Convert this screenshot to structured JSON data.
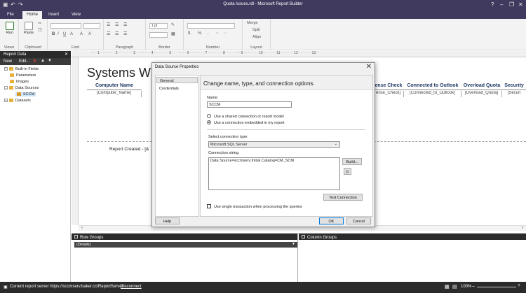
{
  "window": {
    "title": "Quota Issues.rdl - Microsoft Report Builder",
    "controls": [
      "?",
      "–",
      "❐",
      "✕"
    ]
  },
  "ribbon_tabs": [
    "File",
    "Home",
    "Insert",
    "View"
  ],
  "ribbon": {
    "run_label": "Run",
    "paste_label": "Paste",
    "groups": [
      "Views",
      "Clipboard",
      "Font",
      "Paragraph",
      "Border",
      "Number",
      "Layout"
    ],
    "border_width": "1 pt",
    "merge_label": "Merge",
    "split_label": "Split",
    "align_label": "Align"
  },
  "report_data": {
    "title": "Report Data",
    "close": "✕",
    "toolbar": {
      "new": "New",
      "edit": "Edit..."
    },
    "tree": [
      {
        "label": "Built-in Fields",
        "expander": "+"
      },
      {
        "label": "Parameters",
        "expander": ""
      },
      {
        "label": "Images",
        "expander": ""
      },
      {
        "label": "Data Sources",
        "expander": "–"
      },
      {
        "label": "SCCM",
        "expander": ""
      },
      {
        "label": "Datasets",
        "expander": "+"
      }
    ]
  },
  "ruler_text": "· · · 1 · · · · · · · 2 · · · · · · · 3 · · · · · · · 4 · · · · · · · 5 · · · · · · · 6 · · · · · · · 7 · · · · · · · 8 · · · · · · · 9 · · · · · · · 10 · · · · · · 11 · · · · · · 12 · · · · · · 13 ·",
  "report": {
    "title": "Systems Wit",
    "columns": [
      {
        "header": "Computer Name",
        "cell": "[Computer_Name]"
      },
      {
        "header": "ense Check",
        "cell": "ense_Check]"
      },
      {
        "header": "Connected to Outlook",
        "cell": "[Connected_to_Outlook]"
      },
      {
        "header": "Overload Quota",
        "cell": "[Overload_Quota]"
      },
      {
        "header": "Security",
        "cell": "[Securi"
      }
    ],
    "footer": "Report Created  - [&"
  },
  "groups": {
    "row_label": "Row Groups",
    "row_item": "(Details)",
    "column_label": "Column Groups"
  },
  "status": {
    "server": "Current report server https://sccmserv.baker.cc/ReportServer",
    "disconnect": "Disconnect",
    "zoom": "100%"
  },
  "dialog": {
    "title": "Data Source Properties",
    "close": "✕",
    "nav": [
      "General",
      "Credentials"
    ],
    "heading": "Change name, type, and connection options.",
    "name_label": "Name:",
    "name_value": "SCCM",
    "radio_shared": "Use a shared connection or report model",
    "radio_embedded": "Use a connection embedded in my report",
    "type_label": "Select connection type:",
    "type_value": "Microsoft SQL Server",
    "conn_label": "Connection string:",
    "conn_value": "Data Source=sccmserv;Initial Catalog=CM_SCM",
    "build_label": "Build...",
    "fx_label": "fx",
    "test_label": "Test Connection",
    "single_txn_label": "Use single transaction when processing the queries",
    "help_label": "Help",
    "ok_label": "OK",
    "cancel_label": "Cancel"
  }
}
